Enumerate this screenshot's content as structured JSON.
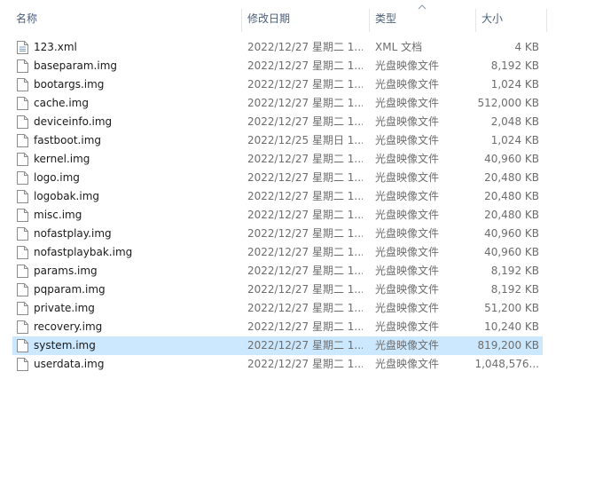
{
  "columns": {
    "name": "名称",
    "date": "修改日期",
    "type": "类型",
    "size": "大小"
  },
  "files": [
    {
      "name": "123.xml",
      "date": "2022/12/27 星期二 1...",
      "type": "XML 文档",
      "size": "4 KB",
      "icon": "xml-file-icon",
      "selected": false
    },
    {
      "name": "baseparam.img",
      "date": "2022/12/27 星期二 1...",
      "type": "光盘映像文件",
      "size": "8,192 KB",
      "icon": "disc-image-file-icon",
      "selected": false
    },
    {
      "name": "bootargs.img",
      "date": "2022/12/27 星期二 1...",
      "type": "光盘映像文件",
      "size": "1,024 KB",
      "icon": "disc-image-file-icon",
      "selected": false
    },
    {
      "name": "cache.img",
      "date": "2022/12/27 星期二 1...",
      "type": "光盘映像文件",
      "size": "512,000 KB",
      "icon": "disc-image-file-icon",
      "selected": false
    },
    {
      "name": "deviceinfo.img",
      "date": "2022/12/27 星期二 1...",
      "type": "光盘映像文件",
      "size": "2,048 KB",
      "icon": "disc-image-file-icon",
      "selected": false
    },
    {
      "name": "fastboot.img",
      "date": "2022/12/25 星期日 1...",
      "type": "光盘映像文件",
      "size": "1,024 KB",
      "icon": "disc-image-file-icon",
      "selected": false
    },
    {
      "name": "kernel.img",
      "date": "2022/12/27 星期二 1...",
      "type": "光盘映像文件",
      "size": "40,960 KB",
      "icon": "disc-image-file-icon",
      "selected": false
    },
    {
      "name": "logo.img",
      "date": "2022/12/27 星期二 1...",
      "type": "光盘映像文件",
      "size": "20,480 KB",
      "icon": "disc-image-file-icon",
      "selected": false
    },
    {
      "name": "logobak.img",
      "date": "2022/12/27 星期二 1...",
      "type": "光盘映像文件",
      "size": "20,480 KB",
      "icon": "disc-image-file-icon",
      "selected": false
    },
    {
      "name": "misc.img",
      "date": "2022/12/27 星期二 1...",
      "type": "光盘映像文件",
      "size": "20,480 KB",
      "icon": "disc-image-file-icon",
      "selected": false
    },
    {
      "name": "nofastplay.img",
      "date": "2022/12/27 星期二 1...",
      "type": "光盘映像文件",
      "size": "40,960 KB",
      "icon": "disc-image-file-icon",
      "selected": false
    },
    {
      "name": "nofastplaybak.img",
      "date": "2022/12/27 星期二 1...",
      "type": "光盘映像文件",
      "size": "40,960 KB",
      "icon": "disc-image-file-icon",
      "selected": false
    },
    {
      "name": "params.img",
      "date": "2022/12/27 星期二 1...",
      "type": "光盘映像文件",
      "size": "8,192 KB",
      "icon": "disc-image-file-icon",
      "selected": false
    },
    {
      "name": "pqparam.img",
      "date": "2022/12/27 星期二 1...",
      "type": "光盘映像文件",
      "size": "8,192 KB",
      "icon": "disc-image-file-icon",
      "selected": false
    },
    {
      "name": "private.img",
      "date": "2022/12/27 星期二 1...",
      "type": "光盘映像文件",
      "size": "51,200 KB",
      "icon": "disc-image-file-icon",
      "selected": false
    },
    {
      "name": "recovery.img",
      "date": "2022/12/27 星期二 1...",
      "type": "光盘映像文件",
      "size": "10,240 KB",
      "icon": "disc-image-file-icon",
      "selected": false
    },
    {
      "name": "system.img",
      "date": "2022/12/27 星期二 1...",
      "type": "光盘映像文件",
      "size": "819,200 KB",
      "icon": "disc-image-file-icon",
      "selected": true
    },
    {
      "name": "userdata.img",
      "date": "2022/12/27 星期二 1...",
      "type": "光盘映像文件",
      "size": "1,048,576...",
      "icon": "disc-image-file-icon",
      "selected": false
    }
  ],
  "colors": {
    "header_text": "#4c607a",
    "selection": "#cce8ff",
    "secondary_text": "#6d6d6d"
  }
}
